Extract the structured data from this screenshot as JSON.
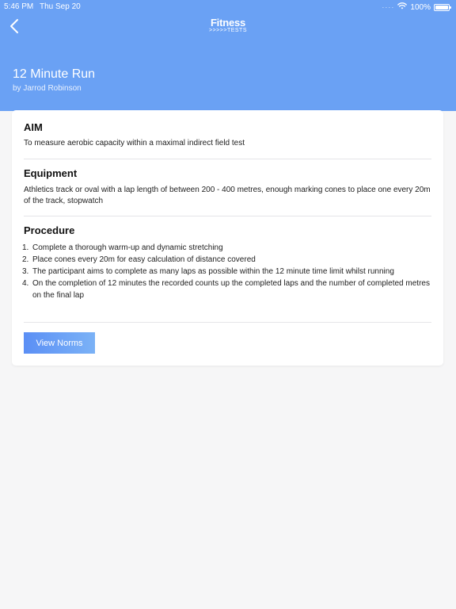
{
  "status_bar": {
    "time": "5:46 PM",
    "date": "Thu Sep 20",
    "battery": "100%",
    "battery_level": 1.0
  },
  "nav": {
    "back_icon": "chevron-left-icon",
    "logo_top": "Fitness",
    "logo_bottom": ">>>>>TESTS"
  },
  "test": {
    "title": "12 Minute Run",
    "author": "by Jarrod Robinson"
  },
  "aim": {
    "heading": "AIM",
    "text": "To measure aerobic capacity within a maximal indirect field test"
  },
  "equipment": {
    "heading": "Equipment",
    "text": "Athletics track or oval with a lap length of between 200 - 400 metres, enough marking cones to place one every 20m of the track, stopwatch"
  },
  "procedure": {
    "heading": "Procedure",
    "steps": [
      {
        "num": "1.",
        "text": "Complete a thorough warm-up and dynamic stretching"
      },
      {
        "num": "2.",
        "text": "Place cones every 20m for easy calculation of distance covered"
      },
      {
        "num": "3.",
        "text": "The participant aims to complete as many laps as possible within the 12 minute time limit whilst running"
      },
      {
        "num": "4.",
        "text": "On the completion of 12 minutes the recorded counts up the completed laps and the number of completed metres on the final lap"
      }
    ]
  },
  "actions": {
    "view_norms_label": "View Norms"
  },
  "colors": {
    "header_blue": "#6aa1f4",
    "button_gradient_start": "#5b8ff5",
    "button_gradient_end": "#7bb2f6",
    "background": "#f6f6f7"
  }
}
